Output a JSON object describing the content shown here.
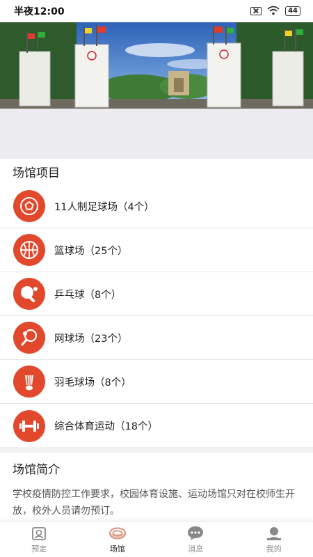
{
  "status_bar": {
    "time": "半夜12:00",
    "battery": "44"
  },
  "banner": {
    "slide_count": 5,
    "active_slide": 0
  },
  "venues": {
    "title": "场馆项目",
    "items": [
      {
        "label": "11人制足球场（4个）",
        "icon": "soccer-icon"
      },
      {
        "label": "篮球场（25个）",
        "icon": "basketball-icon"
      },
      {
        "label": "乒乓球（8个）",
        "icon": "ping-pong-icon"
      },
      {
        "label": "网球场（23个）",
        "icon": "tennis-icon"
      },
      {
        "label": "羽毛球场（8个）",
        "icon": "badminton-icon"
      },
      {
        "label": "综合体育运动（18个）",
        "icon": "dumbbell-icon"
      }
    ]
  },
  "intro": {
    "title": "场馆简介",
    "text": "学校疫情防控工作要求，校园体育设施、运动场馆只对在校师生开放，校外人员请勿预订。"
  },
  "tabbar": {
    "tabs": [
      {
        "label": "预定",
        "icon": "booking-icon"
      },
      {
        "label": "场馆",
        "icon": "venue-icon"
      },
      {
        "label": "消息",
        "icon": "message-icon"
      },
      {
        "label": "我的",
        "icon": "profile-icon"
      }
    ],
    "active": "场馆"
  },
  "colors": {
    "accent": "#e2492c",
    "tab_active": "#d9917a",
    "tab_inactive": "#8a8a8a"
  }
}
